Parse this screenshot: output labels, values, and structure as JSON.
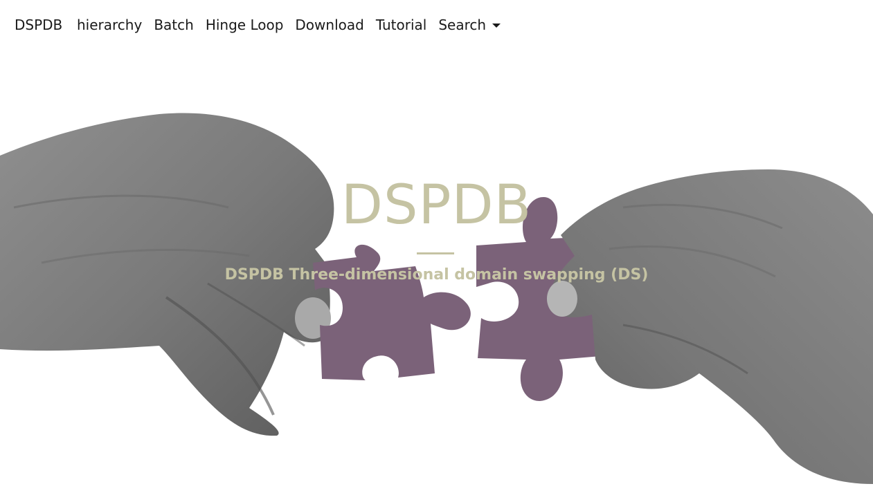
{
  "nav": {
    "brand": "DSPDB",
    "links": [
      "hierarchy",
      "Batch",
      "Hinge Loop",
      "Download",
      "Tutorial"
    ],
    "dropdown_label": "Search"
  },
  "hero": {
    "title": "DSPDB",
    "subtitle": "DSPDB Three-dimensional domain swapping (DS)",
    "image_description_icon": "puzzle-hands-image"
  },
  "colors": {
    "hero_text": "#c5c3a3",
    "puzzle": "#7b6279",
    "nav_text": "#1a1a1a"
  }
}
